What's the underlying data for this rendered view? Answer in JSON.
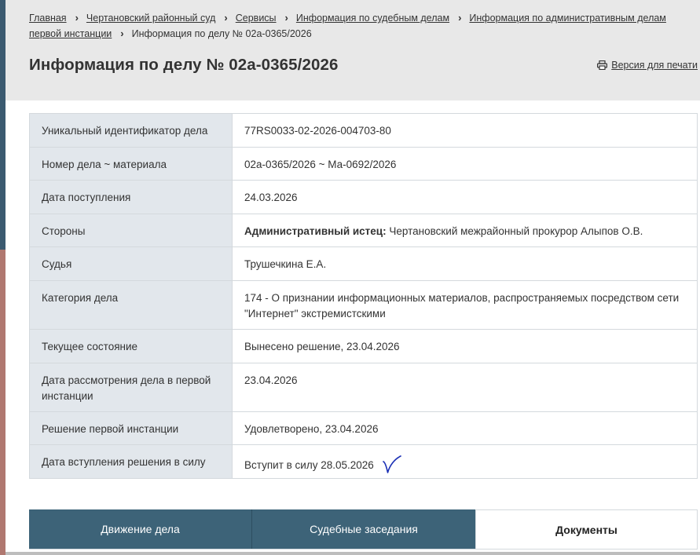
{
  "breadcrumb": {
    "items": [
      {
        "label": "Главная"
      },
      {
        "label": "Чертановский районный суд"
      },
      {
        "label": "Сервисы"
      },
      {
        "label": "Информация по судебным делам"
      },
      {
        "label": "Информация по административным делам первой инстанции"
      }
    ],
    "current": "Информация по делу № 02а-0365/2026",
    "separator": "›"
  },
  "page": {
    "title": "Информация по делу № 02а-0365/2026",
    "print_label": "Версия для печати"
  },
  "case_info": {
    "rows": [
      {
        "label": "Уникальный идентификатор дела",
        "value": "77RS0033-02-2026-004703-80"
      },
      {
        "label": "Номер дела ~ материала",
        "value": "02а-0365/2026 ~ Ма-0692/2026"
      },
      {
        "label": "Дата поступления",
        "value": "24.03.2026"
      },
      {
        "label": "Стороны",
        "value_prefix": "Административный истец:",
        "value": "Чертановский межрайонный прокурор Алыпов О.В."
      },
      {
        "label": "Судья",
        "value": "Трушечкина Е.А."
      },
      {
        "label": "Категория дела",
        "value": "174 - О признании информационных материалов, распространяемых посредством сети \"Интернет\" экстремистскими"
      },
      {
        "label": "Текущее состояние",
        "value": "Вынесено решение, 23.04.2026"
      },
      {
        "label": "Дата рассмотрения дела в первой инстанции",
        "value": "23.04.2026"
      },
      {
        "label": "Решение первой инстанции",
        "value": "Удовлетворено, 23.04.2026"
      },
      {
        "label": "Дата вступления решения в силу",
        "value": "Вступит в силу 28.05.2026"
      }
    ]
  },
  "tabs": [
    {
      "label": "Движение дела",
      "active": false
    },
    {
      "label": "Судебные заседания",
      "active": false
    },
    {
      "label": "Документы",
      "active": true
    }
  ],
  "icons": {
    "print": "printer-icon",
    "annotation": "handwritten-checkmark-icon",
    "crumb_separator": "chevron-right"
  },
  "colors": {
    "header_bg": "#e8e8e8",
    "label_bg": "#e2e7ec",
    "tab_bg": "#3d6378",
    "checkmark": "#1a2fb5"
  }
}
